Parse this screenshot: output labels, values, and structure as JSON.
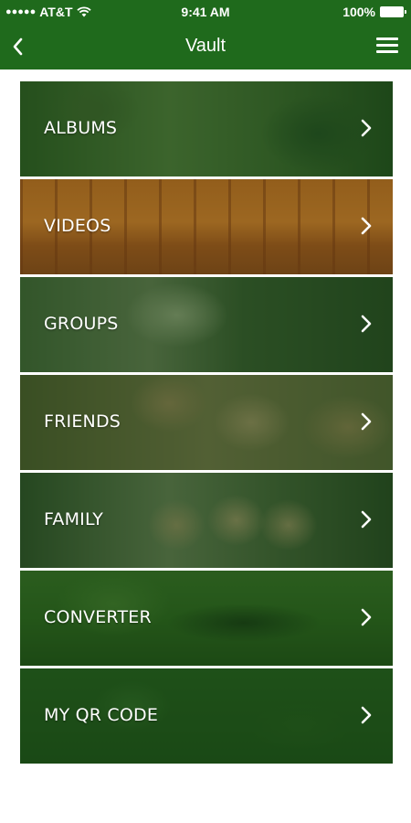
{
  "status_bar": {
    "signal": "●●●●●",
    "carrier": "AT&T",
    "time": "9:41 AM",
    "battery": "100%"
  },
  "nav": {
    "title": "Vault",
    "back_icon": "chevron-left-icon",
    "menu_icon": "hamburger-menu-icon"
  },
  "menu": {
    "items": [
      {
        "label": "ALBUMS"
      },
      {
        "label": "VIDEOS"
      },
      {
        "label": "GROUPS"
      },
      {
        "label": "FRIENDS"
      },
      {
        "label": "FAMILY"
      },
      {
        "label": "CONVERTER"
      },
      {
        "label": "MY QR CODE"
      }
    ]
  },
  "colors": {
    "primary_green": "#1f6a1c",
    "overlay_green": "#124610",
    "text": "#ffffff",
    "background": "#ffffff"
  }
}
